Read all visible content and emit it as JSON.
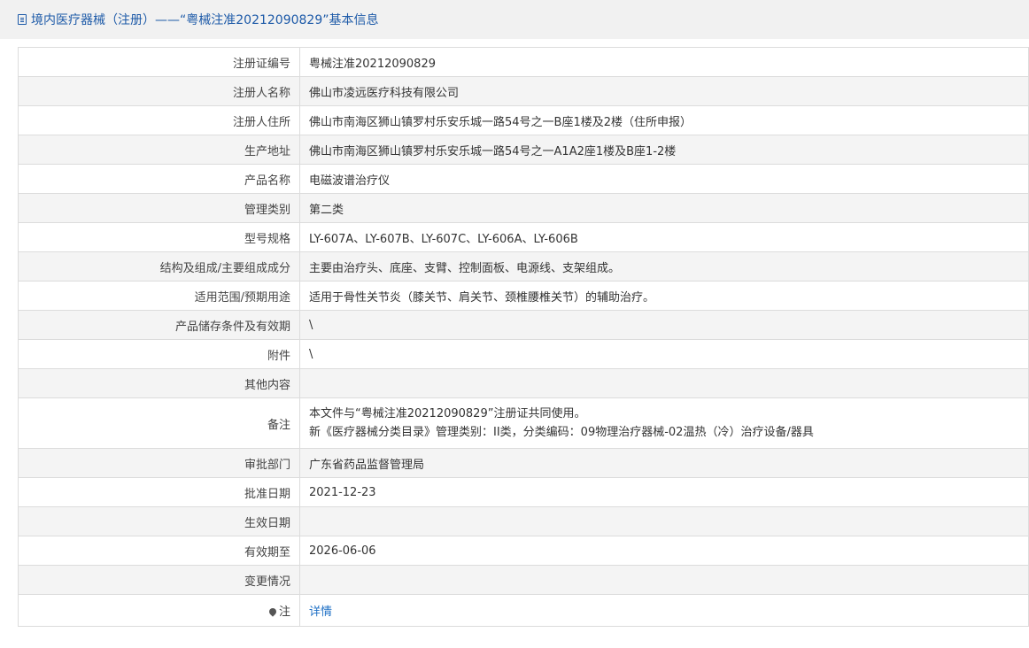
{
  "header": {
    "title": "境内医疗器械（注册）——“粤械注准20212090829”基本信息"
  },
  "rows": [
    {
      "label": "注册证编号",
      "value": "粤械注准20212090829"
    },
    {
      "label": "注册人名称",
      "value": "佛山市凌远医疗科技有限公司"
    },
    {
      "label": "注册人住所",
      "value": "佛山市南海区狮山镇罗村乐安乐城一路54号之一B座1楼及2楼（住所申报）"
    },
    {
      "label": "生产地址",
      "value": "佛山市南海区狮山镇罗村乐安乐城一路54号之一A1A2座1楼及B座1-2楼"
    },
    {
      "label": "产品名称",
      "value": "电磁波谱治疗仪"
    },
    {
      "label": "管理类别",
      "value": "第二类"
    },
    {
      "label": "型号规格",
      "value": "LY-607A、LY-607B、LY-607C、LY-606A、LY-606B"
    },
    {
      "label": "结构及组成/主要组成成分",
      "value": "主要由治疗头、底座、支臂、控制面板、电源线、支架组成。"
    },
    {
      "label": "适用范围/预期用途",
      "value": "适用于骨性关节炎（膝关节、肩关节、颈椎腰椎关节）的辅助治疗。"
    },
    {
      "label": "产品储存条件及有效期",
      "value": "\\"
    },
    {
      "label": "附件",
      "value": "\\"
    },
    {
      "label": "其他内容",
      "value": ""
    }
  ],
  "remark": {
    "label": "备注",
    "line1": "本文件与“粤械注准20212090829”注册证共同使用。",
    "line2": "新《医疗器械分类目录》管理类别：II类，分类编码：09物理治疗器械-02温热（冷）治疗设备/器具"
  },
  "rows_after": [
    {
      "label": "审批部门",
      "value": "广东省药品监督管理局"
    },
    {
      "label": "批准日期",
      "value": "2021-12-23"
    },
    {
      "label": "生效日期",
      "value": ""
    },
    {
      "label": "有效期至",
      "value": "2026-06-06"
    },
    {
      "label": "变更情况",
      "value": ""
    }
  ],
  "note": {
    "label": "注",
    "link_text": "详情",
    "icon": "pin-icon"
  }
}
